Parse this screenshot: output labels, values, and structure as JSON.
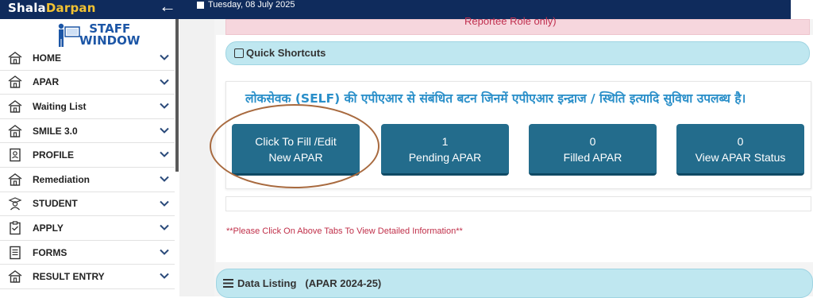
{
  "header": {
    "brand_part1": "Shala",
    "brand_part2": "Darpan",
    "date": "Tuesday, 08 July 2025"
  },
  "logo": {
    "line1": "STAFF",
    "line2": "WINDOW"
  },
  "sidebar": {
    "items": [
      {
        "label": "HOME",
        "icon": "home-icon"
      },
      {
        "label": "APAR",
        "icon": "home-icon"
      },
      {
        "label": "Waiting List",
        "icon": "home-icon"
      },
      {
        "label": "SMILE 3.0",
        "icon": "home-icon"
      },
      {
        "label": "PROFILE",
        "icon": "profile-card-icon"
      },
      {
        "label": "Remediation",
        "icon": "home-icon"
      },
      {
        "label": "STUDENT",
        "icon": "student-icon"
      },
      {
        "label": "APPLY",
        "icon": "clipboard-icon"
      },
      {
        "label": "FORMS",
        "icon": "form-icon"
      },
      {
        "label": "RESULT ENTRY",
        "icon": "home-icon"
      }
    ]
  },
  "notice_strip": {
    "text": "Reportee Role only)"
  },
  "quick_shortcuts": {
    "title": "Quick Shortcuts",
    "hindi_text": "लोकसेवक (SELF) की एपीएआर से संबंधित बटन जिनमें एपीएआर इन्द्राज / स्थिति इत्यादि सुविधा उपलब्ध है।",
    "buttons": [
      {
        "line1": "Click To Fill /Edit",
        "line2": "New APAR"
      },
      {
        "line1": "1",
        "line2": "Pending APAR"
      },
      {
        "line1": "0",
        "line2": "Filled APAR"
      },
      {
        "line1": "0",
        "line2": "View APAR Status"
      }
    ],
    "note": "**Please Click On Above Tabs To View Detailed Information**"
  },
  "data_listing": {
    "title": "Data Listing",
    "subtitle": "(APAR 2024-25)"
  },
  "colors": {
    "topbar": "#0f2b5c",
    "brand_accent": "#f1c232",
    "button": "#236c8c",
    "section_bar": "#bfe7f0",
    "hindi_text": "#2a8fc9",
    "note_text": "#c0304a"
  }
}
